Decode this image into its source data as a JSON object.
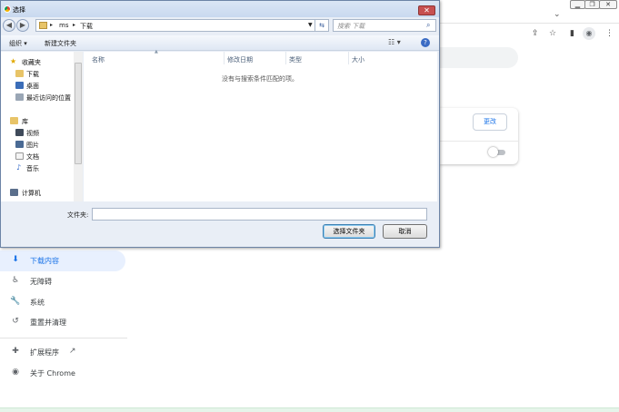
{
  "chrome": {
    "window_min": "▁",
    "window_max": "❐",
    "window_close": "✕",
    "tab_dropdown": "⌄",
    "change_button": "更改",
    "sidebar": [
      {
        "icon": "download-icon",
        "glyph": "⬇",
        "label": "下载内容",
        "active": true
      },
      {
        "icon": "accessibility-icon",
        "glyph": "♿",
        "label": "无障碍"
      },
      {
        "icon": "wrench-icon",
        "glyph": "🔧",
        "label": "系统"
      },
      {
        "icon": "reset-icon",
        "glyph": "↺",
        "label": "重置并清理"
      },
      {
        "icon": "extension-icon",
        "glyph": "✚",
        "label": "扩展程序"
      },
      {
        "icon": "chrome-icon",
        "glyph": "◉",
        "label": "关于 Chrome"
      }
    ],
    "external_link_glyph": "↗",
    "toolbar_glyphs": [
      "⇪",
      "☆",
      "▮",
      "◉",
      "⋮"
    ],
    "accent_color": "#1a73e8",
    "active_bg": "#e8f0fe"
  },
  "dialog": {
    "title": "选择",
    "close_glyph": "✕",
    "breadcrumb": [
      "ms",
      "下载"
    ],
    "search_placeholder": "搜索 下载",
    "toolbar": {
      "organize": "组织 ▾",
      "new_folder": "新建文件夹",
      "view_glyph": "☷ ▾",
      "help_glyph": "?"
    },
    "nav": {
      "favorites": "收藏夹",
      "fav_items": [
        "下载",
        "桌面",
        "最近访问的位置"
      ],
      "libraries": "库",
      "lib_items": [
        "视频",
        "图片",
        "文档",
        "音乐"
      ],
      "computer": "计算机"
    },
    "columns": [
      "名称",
      "修改日期",
      "类型",
      "大小"
    ],
    "empty_message": "没有与搜索条件匹配的项。",
    "filename_label": "文件夹:",
    "filename_value": "",
    "select_button": "选择文件夹",
    "cancel_button": "取消"
  }
}
